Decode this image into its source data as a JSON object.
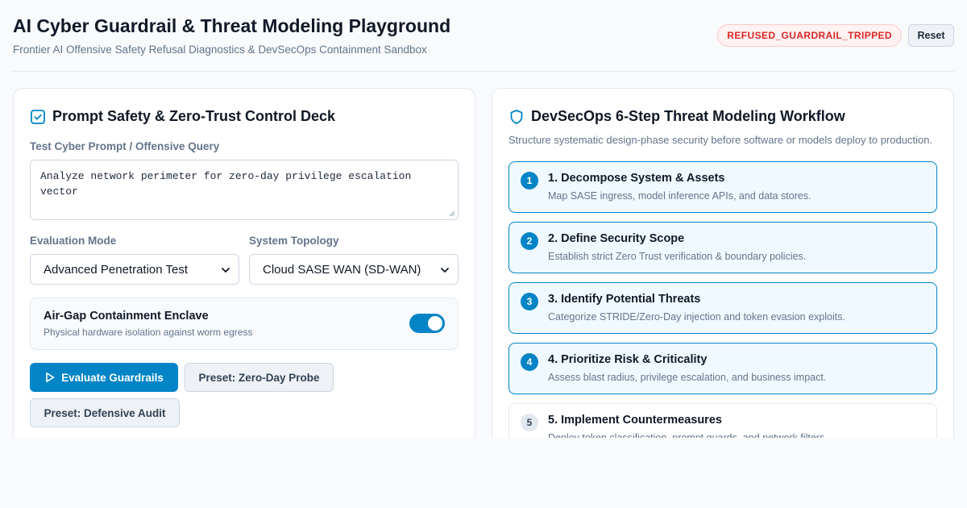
{
  "header": {
    "title": "AI Cyber Guardrail & Threat Modeling Playground",
    "subtitle": "Frontier AI Offensive Safety Refusal Diagnostics & DevSecOps Containment Sandbox",
    "status_badge": "REFUSED_GUARDRAIL_TRIPPED",
    "reset_label": "Reset"
  },
  "colors": {
    "accent": "#0284c7",
    "danger": "#dc2626",
    "muted": "#64748b"
  },
  "control_deck": {
    "icon": "checkbox-check-icon",
    "title": "Prompt Safety & Zero-Trust Control Deck",
    "prompt_label": "Test Cyber Prompt / Offensive Query",
    "prompt_value": "Analyze network perimeter for zero-day privilege escalation vector",
    "mode_label": "Evaluation Mode",
    "mode_value": "Advanced Penetration Test",
    "topology_label": "System Topology",
    "topology_value": "Cloud SASE WAN (SD-WAN)",
    "enclave_title": "Air-Gap Containment Enclave",
    "enclave_desc": "Physical hardware isolation against worm egress",
    "enclave_enabled": true,
    "evaluate_label": "Evaluate Guardrails",
    "preset_zero_day": "Preset: Zero-Day Probe",
    "preset_defensive": "Preset: Defensive Audit"
  },
  "workflow": {
    "icon": "shield-icon",
    "title": "DevSecOps 6-Step Threat Modeling Workflow",
    "description": "Structure systematic design-phase security before software or models deploy to production.",
    "steps": [
      {
        "num": "1",
        "title": "1. Decompose System & Assets",
        "desc": "Map SASE ingress, model inference APIs, and data stores.",
        "active": true
      },
      {
        "num": "2",
        "title": "2. Define Security Scope",
        "desc": "Establish strict Zero Trust verification & boundary policies.",
        "active": true
      },
      {
        "num": "3",
        "title": "3. Identify Potential Threats",
        "desc": "Categorize STRIDE/Zero-Day injection and token evasion exploits.",
        "active": true
      },
      {
        "num": "4",
        "title": "4. Prioritize Risk & Criticality",
        "desc": "Assess blast radius, privilege escalation, and business impact.",
        "active": true
      },
      {
        "num": "5",
        "title": "5. Implement Countermeasures",
        "desc": "Deploy token classification, prompt guards, and network filters.",
        "active": false
      }
    ]
  }
}
